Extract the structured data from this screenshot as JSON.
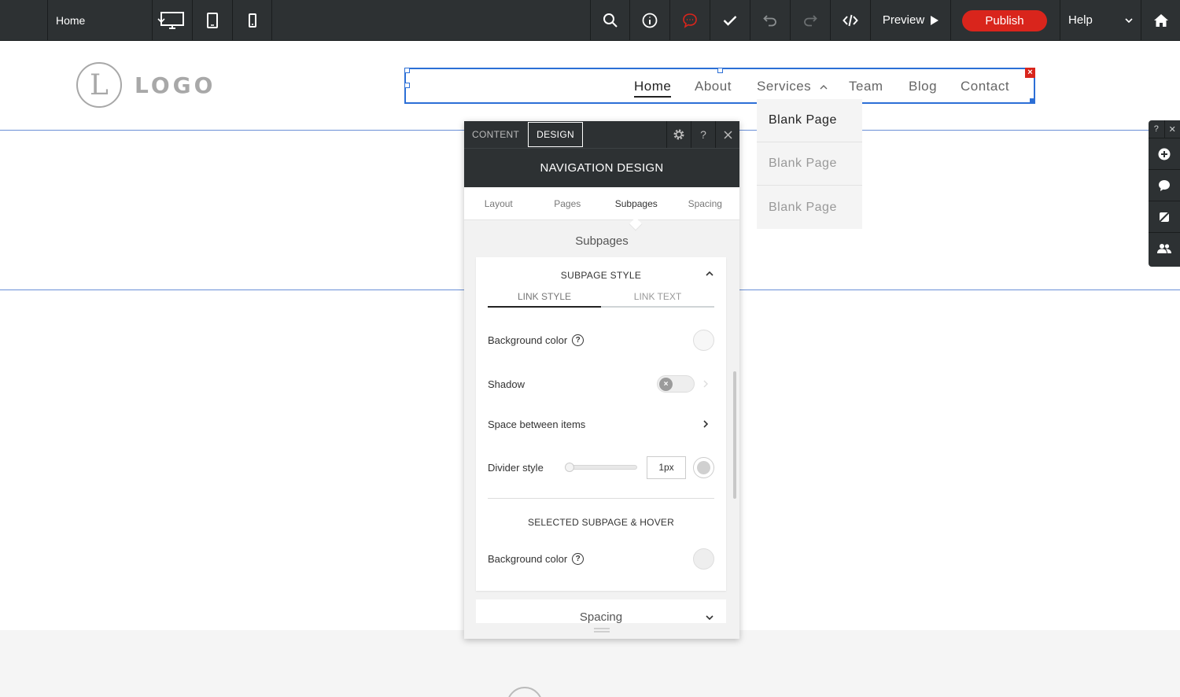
{
  "toolbar": {
    "page_select": "Home",
    "preview_label": "Preview",
    "publish_label": "Publish",
    "help_label": "Help"
  },
  "site": {
    "logo_letter": "L",
    "logo_text": "LOGO",
    "nav": [
      "Home",
      "About",
      "Services",
      "Team",
      "Blog",
      "Contact"
    ],
    "submenu": [
      "Blank Page",
      "Blank Page",
      "Blank Page"
    ]
  },
  "side_tools": {
    "help": "?",
    "close": "✕"
  },
  "panel": {
    "tab_content": "CONTENT",
    "tab_design": "DESIGN",
    "help": "?",
    "title": "NAVIGATION DESIGN",
    "tabs": [
      "Layout",
      "Pages",
      "Subpages",
      "Spacing"
    ],
    "active_tab": "Subpages",
    "section_heading": "Subpages",
    "card": {
      "title": "SUBPAGE STYLE",
      "subtabs": [
        "LINK STYLE",
        "LINK TEXT"
      ],
      "background_color_label": "Background color",
      "shadow_label": "Shadow",
      "shadow_enabled": false,
      "space_between_label": "Space between items",
      "divider_style_label": "Divider style",
      "divider_value": "1px",
      "selected_title": "SELECTED SUBPAGE & HOVER",
      "selected_bg_label": "Background color"
    },
    "next_section": "Spacing"
  },
  "colors": {
    "toolbar_bg": "#2d3133",
    "publish": "#d9251c",
    "selection": "#2c6fd6"
  }
}
